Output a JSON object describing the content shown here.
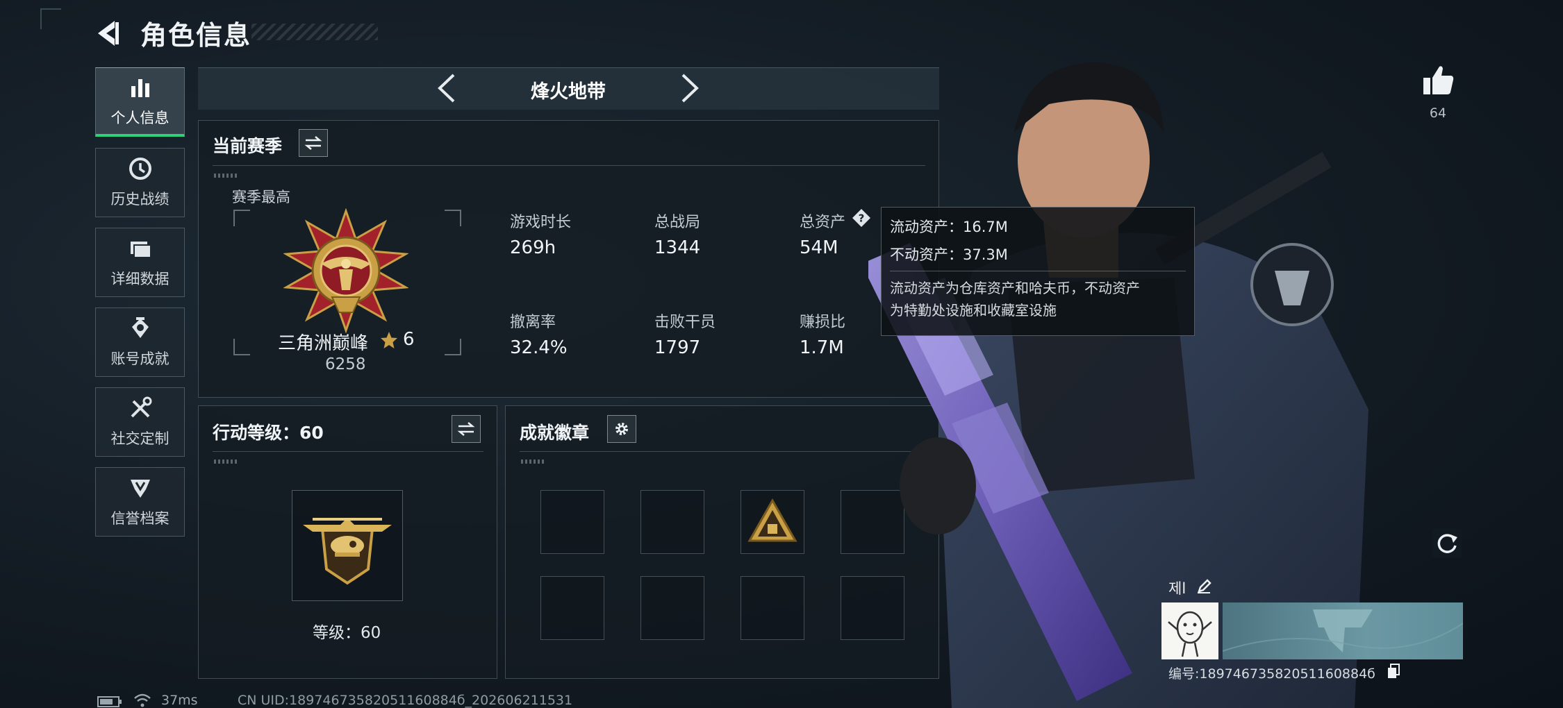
{
  "header": {
    "title": "角色信息"
  },
  "sidebar": {
    "items": [
      {
        "label": "个人信息",
        "icon": "bar-chart-icon",
        "active": true
      },
      {
        "label": "历史战绩",
        "icon": "history-clock-icon"
      },
      {
        "label": "详细数据",
        "icon": "folder-data-icon"
      },
      {
        "label": "账号成就",
        "icon": "achievement-icon"
      },
      {
        "label": "社交定制",
        "icon": "tools-icon"
      },
      {
        "label": "信誉档案",
        "icon": "shield-rank-icon"
      }
    ]
  },
  "mode": {
    "title": "烽火地带"
  },
  "season": {
    "title": "当前赛季",
    "best_label": "赛季最高",
    "rank_name": "三角洲巅峰",
    "rank_stars": "6",
    "rank_score": "6258",
    "stats": [
      {
        "label": "游戏时长",
        "value": "269h"
      },
      {
        "label": "总战局",
        "value": "1344"
      },
      {
        "label": "总资产",
        "value": "54M"
      },
      {
        "label": "撤离率",
        "value": "32.4%"
      },
      {
        "label": "击败干员",
        "value": "1797"
      },
      {
        "label": "赚损比",
        "value": "1.7M"
      }
    ]
  },
  "tooltip": {
    "liquid": "流动资产：16.7M",
    "fixed": "不动资产：37.3M",
    "note_line1": "流动资产为仓库资产和哈夫币，不动资产",
    "note_line2": "为特勤处设施和收藏室设施"
  },
  "action_level": {
    "title": "行动等级：60",
    "level_text": "等级：60"
  },
  "badges": {
    "title": "成就徽章",
    "slots": 8,
    "filled_index": 2
  },
  "profile": {
    "likes": "64",
    "nickname": "제l",
    "card_uid": "编号:18974673582051160884б"
  },
  "status": {
    "ping": "37ms",
    "uid_footer": "CN UID:18974673582051160884б_202606211531"
  },
  "colors": {
    "accent_green": "#2fd07a",
    "gold": "#c9a046",
    "rank_red": "#a3212b"
  }
}
